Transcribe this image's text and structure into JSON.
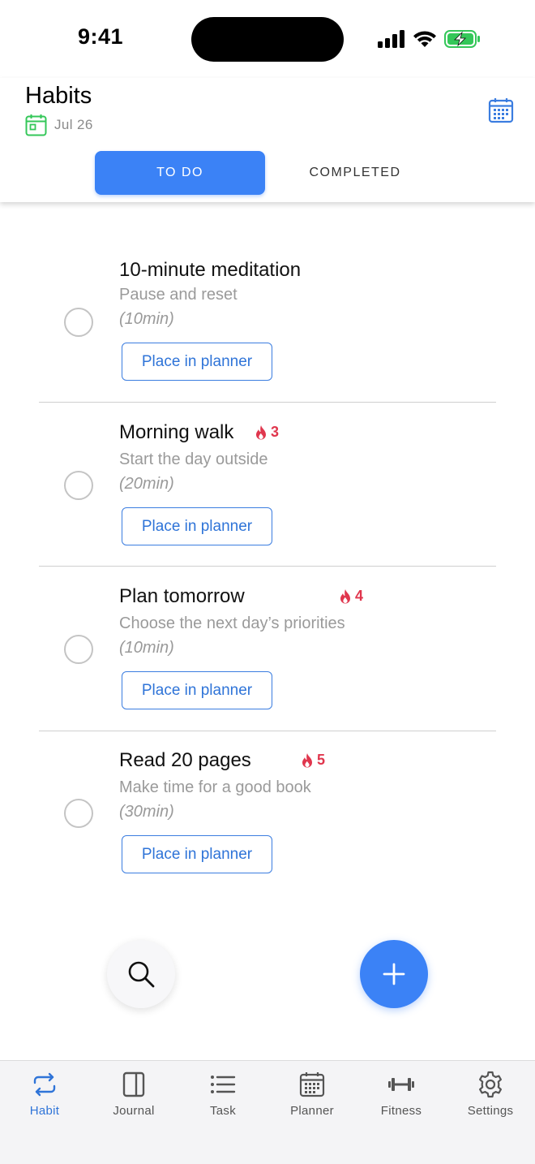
{
  "status_bar": {
    "time": "9:41"
  },
  "header": {
    "title": "Habits",
    "date": "Jul 26",
    "tabs": [
      {
        "label": "TO DO",
        "active": true
      },
      {
        "label": "COMPLETED",
        "active": false
      }
    ]
  },
  "habits": [
    {
      "title": "10-minute meditation",
      "description": "Pause and reset",
      "duration": "(10min)",
      "streak": null,
      "action": "Place in planner"
    },
    {
      "title": "Morning walk",
      "description": "Start the day outside",
      "duration": "(20min)",
      "streak": "3",
      "action": "Place in planner"
    },
    {
      "title": "Plan tomorrow",
      "description": "Choose the next day’s priorities",
      "duration": "(10min)",
      "streak": "4",
      "action": "Place in planner"
    },
    {
      "title": "Read 20 pages",
      "description": "Make time for a good book",
      "duration": "(30min)",
      "streak": "5",
      "action": "Place in planner"
    }
  ],
  "fabs": {
    "search_icon": "search-icon",
    "add_icon": "plus-icon"
  },
  "bottom_nav": [
    {
      "label": "Habit",
      "icon": "repeat-icon",
      "active": true
    },
    {
      "label": "Journal",
      "icon": "journal-icon",
      "active": false
    },
    {
      "label": "Task",
      "icon": "list-icon",
      "active": false
    },
    {
      "label": "Planner",
      "icon": "calendar-icon",
      "active": false
    },
    {
      "label": "Fitness",
      "icon": "dumbbell-icon",
      "active": false
    },
    {
      "label": "Settings",
      "icon": "gear-icon",
      "active": false
    }
  ],
  "colors": {
    "accent": "#3b82f6",
    "streak": "#e0364d",
    "date_icon": "#34c759",
    "muted_text": "#9a9a9a"
  }
}
